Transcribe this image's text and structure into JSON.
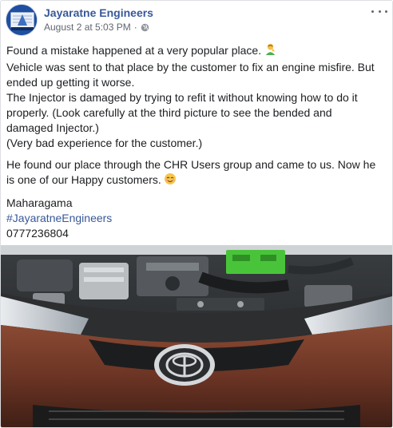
{
  "post": {
    "page_name": "Jayaratne Engineers",
    "timestamp": "August 2 at 5:03 PM",
    "dot": "·",
    "audience_icon": "globe-icon",
    "menu_icon": "more-options-icon",
    "lines": [
      "Found a mistake happened at a very popular place.",
      "Vehicle was sent to that place by the customer to fix an engine misfire. But",
      "ended up getting it worse.",
      "The Injector is damaged by trying to refit it without knowing how to do it",
      "properly. (Look carefully at the third picture to see the bended and",
      "damaged Injector.)",
      "(Very bad experience for the customer.)"
    ],
    "para2_lines": [
      "He found our place through the CHR Users group and came to us. Now he",
      "is one of our Happy customers."
    ],
    "location": "Maharagama",
    "hashtag": "#JayaratneEngineers",
    "phone": "0777236804",
    "emoji_1": "person-facepalming-emoji",
    "emoji_2": "relieved-face-emoji",
    "photo": "car-engine-bay-photo"
  },
  "colors": {
    "link": "#385898",
    "text": "#1c1e21",
    "meta": "#616770",
    "car_body": "#6b3424"
  }
}
